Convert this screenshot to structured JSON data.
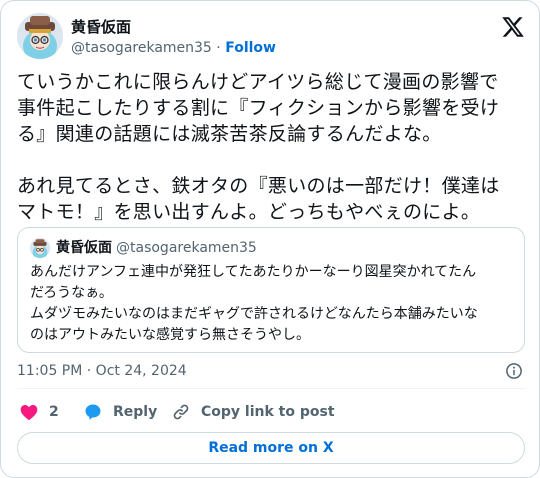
{
  "author": {
    "name": "黄昏仮面",
    "handle": "@tasogarekamen35",
    "separator": "·",
    "follow_label": "Follow"
  },
  "tweet": {
    "text": "ていうかこれに限らんけどアイツら総じて漫画の影響で\n事件起こしたりする割に『フィクションから影響を受け\nる』関連の話題には滅茶苦茶反論するんだよな。\n\nあれ見てるとさ、鉄オタの『悪いのは一部だけ！僕達は\nマトモ！』を思い出すんよ。どっちもやべぇのによ。",
    "timestamp": "11:05 PM · Oct 24, 2024"
  },
  "quoted": {
    "name": "黄昏仮面",
    "handle": "@tasogarekamen35",
    "text": "あんだけアンフェ連中が発狂してたあたりかーなーり図星突かれてたん\nだろうなぁ。\nムダヅモみたいなのはまだギャグで許されるけどなんたら本舗みたいな\nのはアウトみたいな感覚すら無さそうやし。"
  },
  "actions": {
    "like_count": "2",
    "reply_label": "Reply",
    "copy_link_label": "Copy link to post"
  },
  "read_more_label": "Read more on X",
  "colors": {
    "link_blue": "#006fd6",
    "like_pink": "#f91880",
    "reply_blue": "#1d9bf0",
    "muted": "#536471",
    "border": "#cfd9de"
  }
}
